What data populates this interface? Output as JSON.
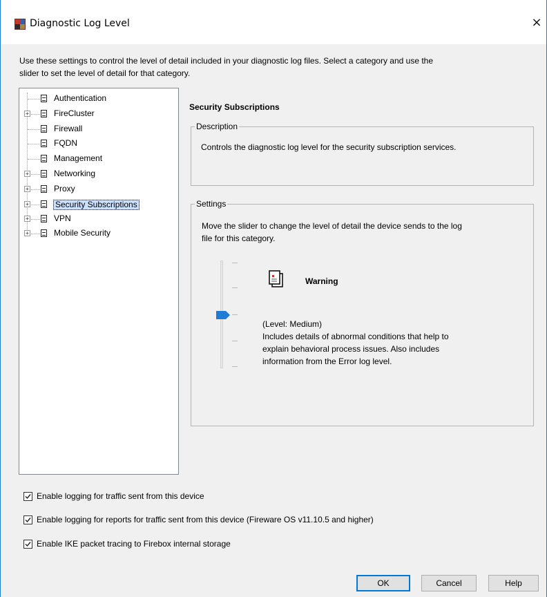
{
  "window": {
    "title": "Diagnostic Log Level",
    "close_glyph": "×"
  },
  "intro": {
    "line1": "Use these settings to control the level of detail included in your diagnostic log files. Select a category and use the",
    "line2": "slider to set the level of detail for that category."
  },
  "tree": {
    "items": [
      {
        "label": "Authentication",
        "expandable": false
      },
      {
        "label": "FireCluster",
        "expandable": true
      },
      {
        "label": "Firewall",
        "expandable": false
      },
      {
        "label": "FQDN",
        "expandable": false
      },
      {
        "label": "Management",
        "expandable": false
      },
      {
        "label": "Networking",
        "expandable": true
      },
      {
        "label": "Proxy",
        "expandable": true
      },
      {
        "label": "Security Subscriptions",
        "expandable": true,
        "selected": true
      },
      {
        "label": "VPN",
        "expandable": true
      },
      {
        "label": "Mobile Security",
        "expandable": true
      }
    ]
  },
  "detail": {
    "title": "Security Subscriptions",
    "description_legend": "Description",
    "description_text": "Controls the diagnostic log level for the security subscription services.",
    "settings_legend": "Settings",
    "settings_line1": "Move the slider to change the level of detail the device sends to the log",
    "settings_line2": "file for this category.",
    "slider": {
      "level_name": "Warning",
      "level_label": "(Level: Medium)",
      "details_line1": "Includes details of abnormal conditions that help to",
      "details_line2": "explain behavioral process issues. Also includes",
      "details_line3": "information from the Error log level.",
      "position_fraction": 0.5
    }
  },
  "options": {
    "traffic_logging": {
      "label": "Enable logging for traffic sent from this device",
      "checked": true
    },
    "reports_logging": {
      "label": "Enable logging for reports for traffic sent from this device (Fireware OS v11.10.5 and higher)",
      "checked": true
    },
    "ike_tracing": {
      "label": "Enable IKE packet tracing to Firebox internal storage",
      "checked": true
    }
  },
  "buttons": {
    "ok": "OK",
    "cancel": "Cancel",
    "help": "Help"
  },
  "colors": {
    "accent": "#0078d7",
    "selection": "#cce0ff",
    "thumb": "#1e7bd6"
  }
}
